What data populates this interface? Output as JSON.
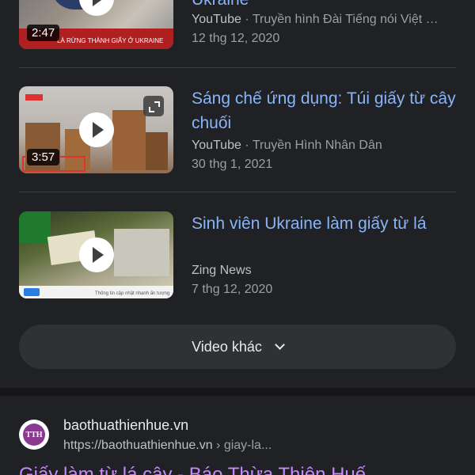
{
  "videos": [
    {
      "title": "Ukraine",
      "duration": "2:47",
      "platform": "YouTube",
      "channel": "Truyền hình Đài Tiếng nói Việt …",
      "date": "12 thg 12, 2020",
      "thumb_caption": "LÀ RỪNG THÀNH GIẤY Ở UKRAINE"
    },
    {
      "title": "Sáng chế ứng dụng: Túi giấy từ cây chuối",
      "duration": "3:57",
      "platform": "YouTube",
      "channel": "Truyền Hình Nhân Dân",
      "date": "30 thg 1, 2021"
    },
    {
      "title": "Sinh viên Ukraine làm giấy từ lá",
      "platform": "Zing News",
      "date": "7 thg 12, 2020",
      "thumb_caption": "Thông tin cập nhật nhanh ấn tượng"
    }
  ],
  "separator": " · ",
  "more_button": {
    "label": "Video khác",
    "icon": "chevron-down-icon"
  },
  "result": {
    "favicon_text": "TTH",
    "site_name": "baothuathienhue.vn",
    "url": "https://baothuathienhue.vn",
    "url_path": " › giay-la...",
    "title": "Giấy làm từ lá cây - Báo Thừa Thiên Huế"
  },
  "colors": {
    "background": "#202124",
    "link_blue": "#8ab4f8",
    "visited_purple": "#c58af9",
    "button_bg": "#303134"
  }
}
